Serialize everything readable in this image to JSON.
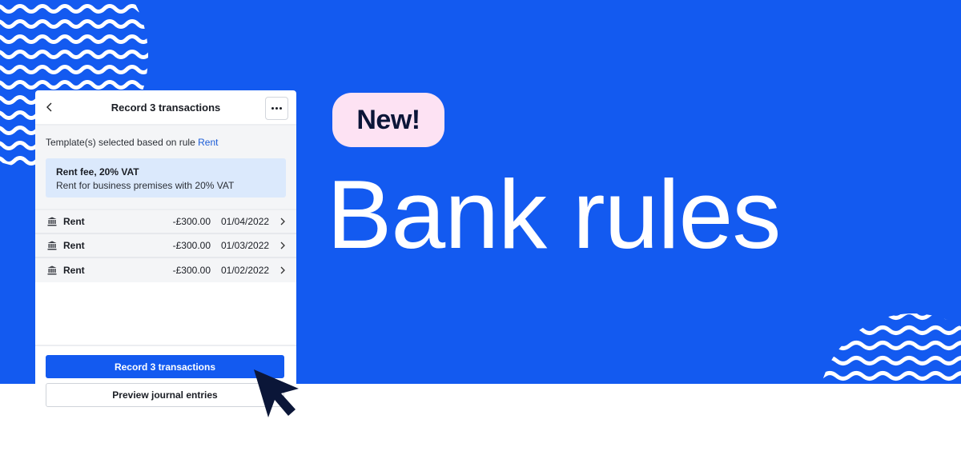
{
  "banner": {
    "badge": "New!",
    "headline": "Bank rules",
    "colors": {
      "background": "#135af0",
      "badge_bg": "#fde2f3",
      "badge_text": "#0b1638"
    }
  },
  "panel": {
    "title": "Record 3 transactions",
    "back_icon": "chevron-left-icon",
    "more_icon": "more-horizontal-icon",
    "rule_prefix": "Template(s) selected based on rule",
    "rule_link": "Rent",
    "template": {
      "name": "Rent fee, 20% VAT",
      "description": "Rent for business premises with 20% VAT"
    },
    "transactions": [
      {
        "icon": "bank-icon",
        "name": "Rent",
        "amount": "-£300.00",
        "date": "01/04/2022"
      },
      {
        "icon": "bank-icon",
        "name": "Rent",
        "amount": "-£300.00",
        "date": "01/03/2022"
      },
      {
        "icon": "bank-icon",
        "name": "Rent",
        "amount": "-£300.00",
        "date": "01/02/2022"
      }
    ],
    "primary_button": "Record 3 transactions",
    "secondary_button": "Preview journal entries"
  }
}
